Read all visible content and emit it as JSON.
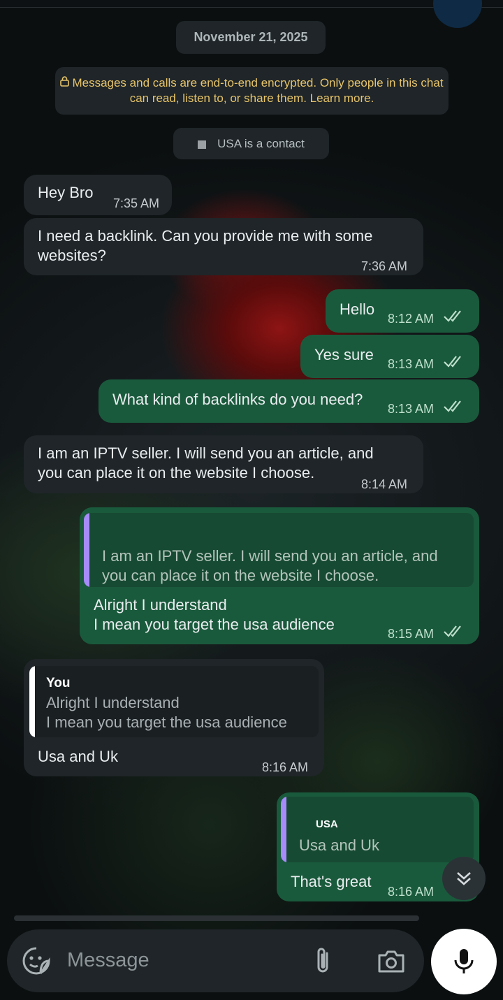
{
  "date": "November 21, 2025",
  "encryption_notice": "Messages and calls are end-to-end encrypted. Only people in this chat can read, listen to, or share them. Learn more.",
  "contact_notice": "USA is a contact",
  "messages": [
    {
      "text": "Hey Bro",
      "time": "7:35 AM"
    },
    {
      "text": "I need a backlink. Can you provide me with some websites?",
      "time": "7:36 AM"
    },
    {
      "text": "Hello",
      "time": "8:12 AM"
    },
    {
      "text": "Yes sure",
      "time": "8:13 AM"
    },
    {
      "text": "What kind of backlinks do you need?",
      "time": "8:13 AM"
    },
    {
      "text": "I am an IPTV seller. I will send you an article, and you can place it on the website I choose.",
      "time": "8:14 AM"
    },
    {
      "quote_text": "I am an IPTV seller. I will send you an article, and you can place it on the website I choose.",
      "text_line1": "Alright I understand",
      "text_line2": "I mean you target the usa audience",
      "time": "8:15 AM"
    },
    {
      "quote_name": "You",
      "quote_line1": "Alright I understand",
      "quote_line2": "I mean you target the usa audience",
      "text": "Usa and Uk",
      "time": "8:16 AM"
    },
    {
      "quote_name": "USA",
      "quote_text": "Usa and Uk",
      "text": "That's great",
      "time": "8:16 AM"
    }
  ],
  "composer": {
    "placeholder": "Message"
  },
  "icons": {
    "lock": "lock-icon",
    "ticks": "double-check-icon",
    "emoji": "sticker-emoji-icon",
    "attach": "paperclip-icon",
    "camera": "camera-icon",
    "mic": "microphone-icon",
    "scroll": "chevron-double-down-icon"
  },
  "colors": {
    "incoming": "#1f2528",
    "outgoing": "#1a5a3c",
    "quote_bar": "#a78bfa",
    "encryption_text": "#e7c46a"
  }
}
